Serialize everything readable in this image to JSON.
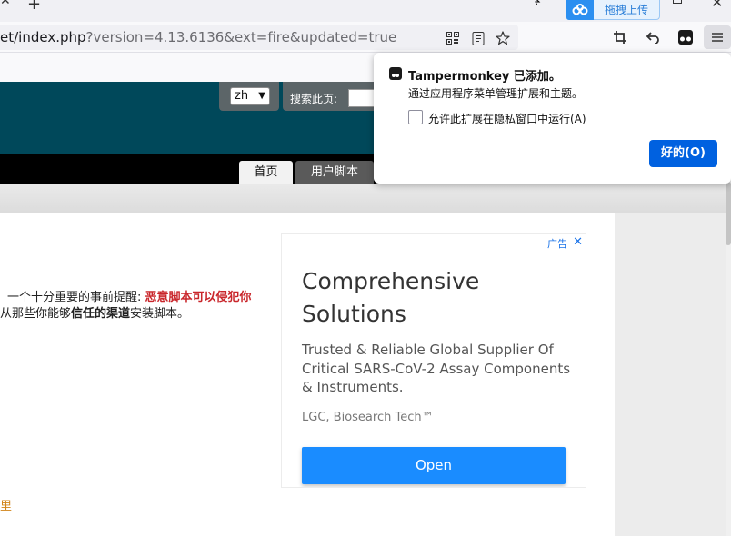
{
  "browser": {
    "url_text": "et/index.php?version=4.13.6136&ext=fire&updated=true",
    "baidu_upload_label": "拖拽上传",
    "icons": {
      "tab_close": "close-icon",
      "new_tab": "plus-icon",
      "qr": "qr-code-icon",
      "reader": "reader-view-icon",
      "bookmark": "star-icon",
      "screenshot": "crop-icon",
      "back": "undo-arrow-icon",
      "tampermonkey": "tampermonkey-icon",
      "menu": "hamburger-menu-icon"
    }
  },
  "site": {
    "lang_value": "zh",
    "search_label": "搜索此页:",
    "tabs": [
      {
        "label": "首页"
      },
      {
        "label": "用户脚本"
      }
    ],
    "notice_text": "一个十分重要的事前提醒: ",
    "notice_warning": "恶意脚本可以侵犯你",
    "notice_line2_a": "从那些你能够",
    "notice_line2_b": "信任的渠道",
    "notice_line2_c": "安装脚本。",
    "orange_text": "里",
    "colors": {
      "header": "#00485a",
      "warning": "#c9262b",
      "link_orange": "#d18419"
    }
  },
  "ad": {
    "label": "广告",
    "title": "Comprehensive Solutions",
    "description": "Trusted & Reliable Global Supplier Of Critical SARS-CoV-2 Assay Components & Instruments.",
    "brand": "LGC, Biosearch Tech™",
    "cta": "Open",
    "cta_color": "#1a8cff"
  },
  "popup": {
    "title": "Tampermonkey 已添加。",
    "subtitle": "通过应用程序菜单管理扩展和主题。",
    "checkbox_label": "允许此扩展在隐私窗口中运行(A)",
    "checkbox_checked": false,
    "ok_label": "好的(O)",
    "ok_color": "#0061e0"
  }
}
